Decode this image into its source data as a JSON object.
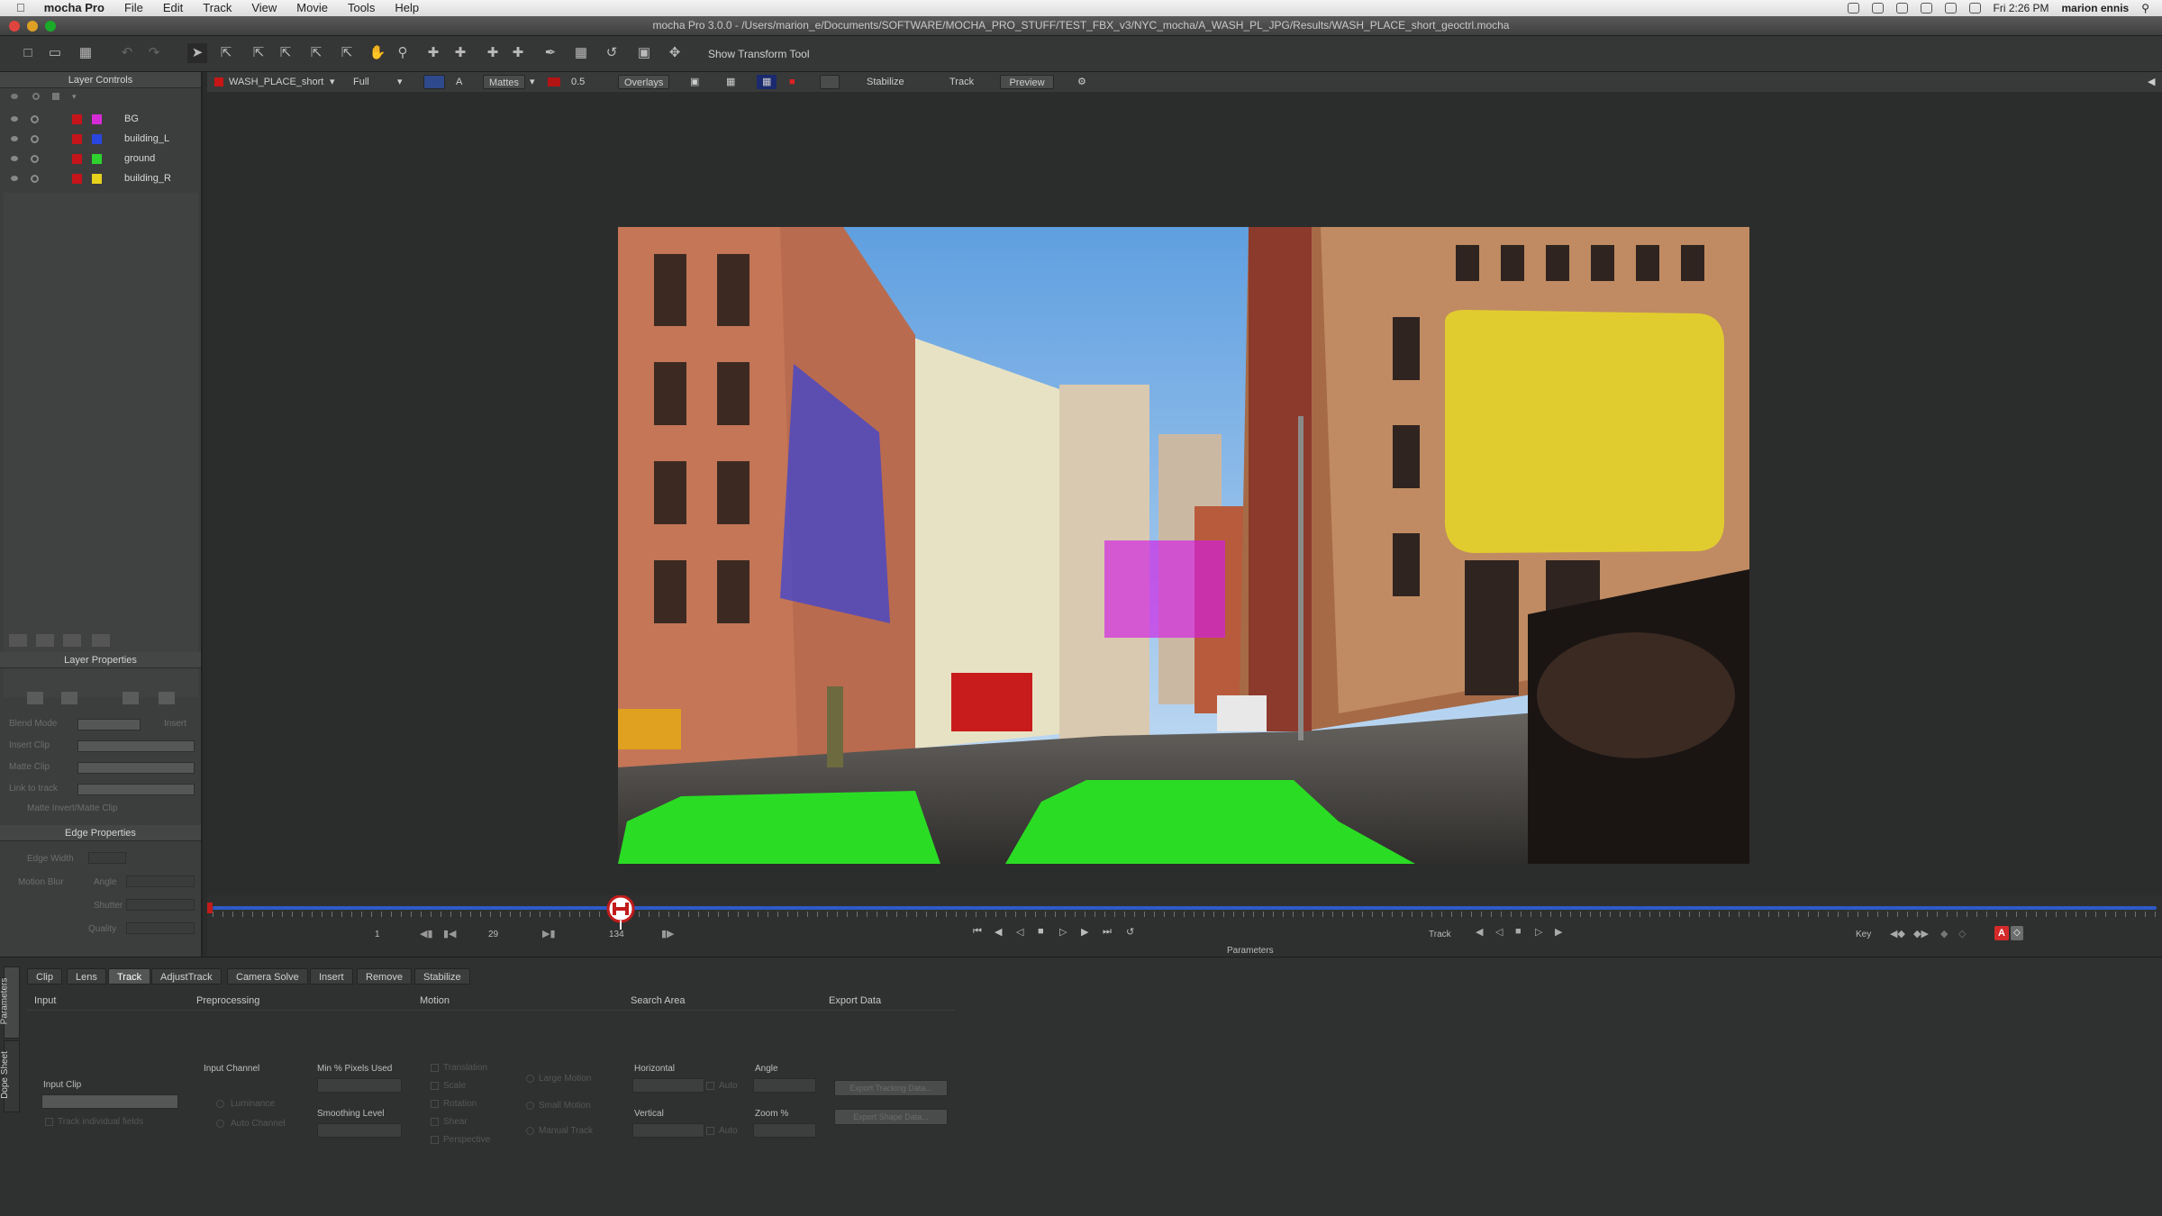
{
  "menubar": {
    "app_name": "mocha Pro",
    "items": [
      "File",
      "Edit",
      "Track",
      "View",
      "Movie",
      "Tools",
      "Help"
    ],
    "clock": "Fri 2:26 PM",
    "user": "marion ennis"
  },
  "window": {
    "title": "mocha Pro 3.0.0 - /Users/marion_e/Documents/SOFTWARE/MOCHA_PRO_STUFF/TEST_FBX_v3/NYC_mocha/A_WASH_PL_JPG/Results/WASH_PLACE_short_geoctrl.mocha"
  },
  "toolbar": {
    "transform_tool_label": "Show Transform Tool"
  },
  "viewer_bar": {
    "clip_name": "WASH_PLACE_short",
    "resolution": "Full",
    "matte_label": "Mattes",
    "opacity": "0.5",
    "overlays_label": "Overlays",
    "stabilize_label": "Stabilize",
    "track_label": "Track",
    "preview_label": "Preview"
  },
  "layer_controls": {
    "title": "Layer Controls",
    "layers": [
      {
        "name": "BG",
        "color": "#d52bd6"
      },
      {
        "name": "building_L",
        "color": "#2a46e0"
      },
      {
        "name": "ground",
        "color": "#2fd12f"
      },
      {
        "name": "building_R",
        "color": "#e6d21c"
      }
    ]
  },
  "layer_properties": {
    "title": "Layer Properties",
    "blend_mode": "Blend Mode",
    "insert": "Insert",
    "insert_clip": "Insert Clip",
    "matte_clip": "Matte Clip",
    "link_to_track": "Link to track",
    "matte_note": "Matte Invert/Matte Clip",
    "edge_title": "Edge Properties",
    "edge_width": "Edge Width",
    "angle": "Angle",
    "motion_blur": "Motion Blur",
    "shutter": "Shutter",
    "quality": "Quality"
  },
  "timeline": {
    "frame_start": "1",
    "frame_current": "29",
    "frame_end": "134",
    "track_label": "Track",
    "key_label": "Key",
    "params_label": "Parameters",
    "playhead_fraction": 0.21
  },
  "bottom_tabs": [
    "Clip",
    "Lens",
    "Track",
    "AdjustTrack",
    "Camera Solve",
    "Insert",
    "Remove",
    "Stabilize"
  ],
  "active_tab": "Track",
  "side_tabs": [
    "Parameters",
    "Dope Sheet"
  ],
  "params": {
    "input": {
      "title": "Input",
      "input_clip": "Input Clip",
      "track_individual": "Track individual fields"
    },
    "preprocessing": {
      "title": "Preprocessing",
      "input_channel": "Input Channel",
      "luminance": "Luminance",
      "auto_channel": "Auto Channel",
      "min_pixels": "Min % Pixels Used",
      "smoothing": "Smoothing Level"
    },
    "motion": {
      "title": "Motion",
      "translation": "Translation",
      "scale": "Scale",
      "rotation": "Rotation",
      "shear": "Shear",
      "perspective": "Perspective",
      "large_motion": "Large Motion",
      "small_motion": "Small Motion",
      "manual_track": "Manual Track"
    },
    "search_area": {
      "title": "Search Area",
      "horizontal": "Horizontal",
      "vertical": "Vertical",
      "auto": "Auto",
      "angle": "Angle",
      "zoom": "Zoom %"
    },
    "export_data": {
      "title": "Export Data",
      "export_tracking": "Export Tracking Data...",
      "export_shape": "Export Shape Data..."
    }
  }
}
